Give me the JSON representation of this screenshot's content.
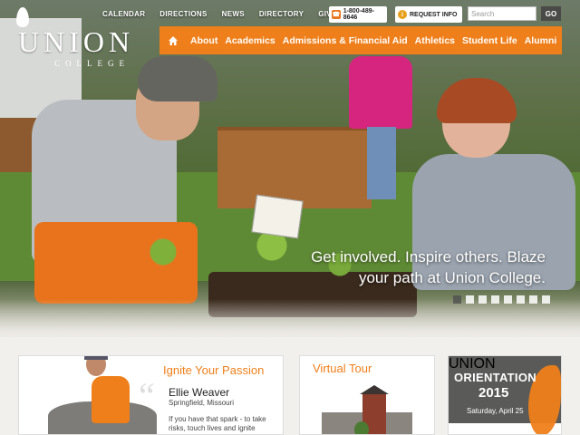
{
  "logo": {
    "wordmark": "UNION",
    "sub": "COLLEGE"
  },
  "utility_nav": [
    "CALENDAR",
    "DIRECTIONS",
    "NEWS",
    "DIRECTORY",
    "GIVE NOW"
  ],
  "phone": {
    "icon": "phone-icon",
    "label": "1-800-489-8646"
  },
  "request_info": {
    "icon": "info-icon",
    "label": "REQUEST INFO"
  },
  "search": {
    "placeholder": "Search",
    "button": "GO"
  },
  "main_nav": {
    "home_icon": "home-icon",
    "items": [
      "About",
      "Academics",
      "Admissions & Financial Aid",
      "Athletics",
      "Student Life",
      "Alumni"
    ]
  },
  "hero": {
    "tagline": "Get involved. Inspire others. Blaze your path at Union College.",
    "slide_count": 8,
    "active_slide": 1
  },
  "cards": {
    "passion": {
      "title": "Ignite Your Passion",
      "name": "Ellie Weaver",
      "place": "Springfield, Missouri",
      "quote": "If you have that spark - to take risks, touch lives and ignite passion - then"
    },
    "tour": {
      "title": "Virtual Tour"
    },
    "orientation": {
      "title_line1": "ORIENTATION",
      "title_line2": "2015",
      "date": "Saturday, April 25",
      "brand": "UNION"
    }
  },
  "colors": {
    "accent": "#ef7f1a",
    "dark": "#4a4a48"
  }
}
